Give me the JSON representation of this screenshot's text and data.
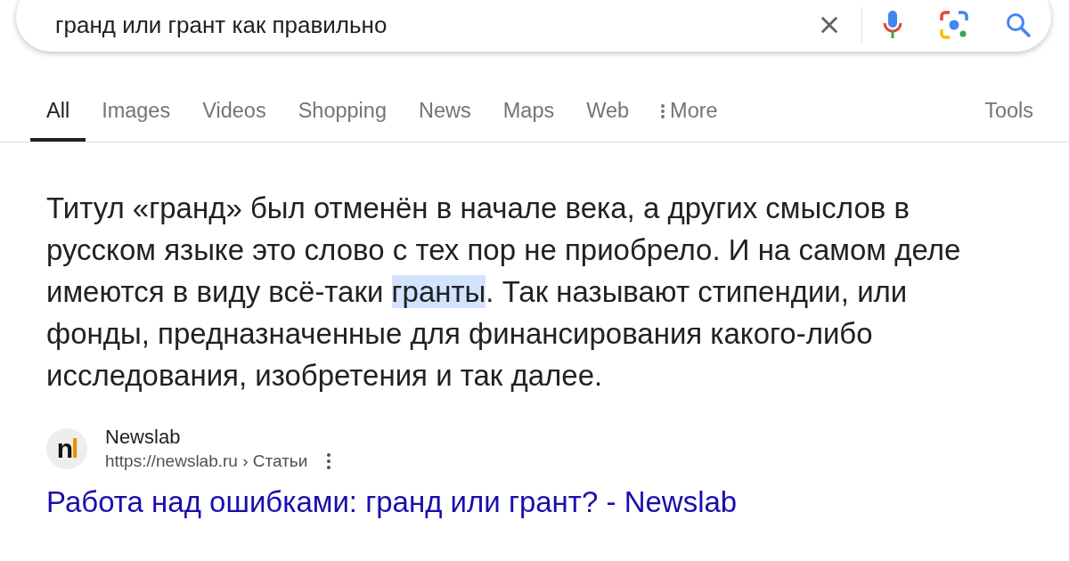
{
  "search": {
    "value": "гранд или грант как правильно"
  },
  "tabs": [
    {
      "label": "All",
      "selected": true
    },
    {
      "label": "Images",
      "selected": false
    },
    {
      "label": "Videos",
      "selected": false
    },
    {
      "label": "Shopping",
      "selected": false
    },
    {
      "label": "News",
      "selected": false
    },
    {
      "label": "Maps",
      "selected": false
    },
    {
      "label": "Web",
      "selected": false
    },
    {
      "label": "More",
      "selected": false,
      "kind": "menu"
    }
  ],
  "tools": "Tools",
  "snippet": [
    {
      "text": "Титул «гранд» был отменён в начале века, а других смыслов в русском языке это слово с тех пор не приобрело. И на самом деле имеются в виду всё-таки ",
      "highlighted": false
    },
    {
      "text": "гранты",
      "highlighted": true
    },
    {
      "text": ". Так называют стипендии, или фонды, предназначенные для финансирования какого-либо исследования, изобретения и так далее.",
      "highlighted": false
    }
  ],
  "source": {
    "logo": "nl",
    "name": "Newslab",
    "url": "https://newslab.ru",
    "breadcrumb": "› Статьи",
    "title": "Работа над ошибками: гранд или грант? - Newslab"
  }
}
